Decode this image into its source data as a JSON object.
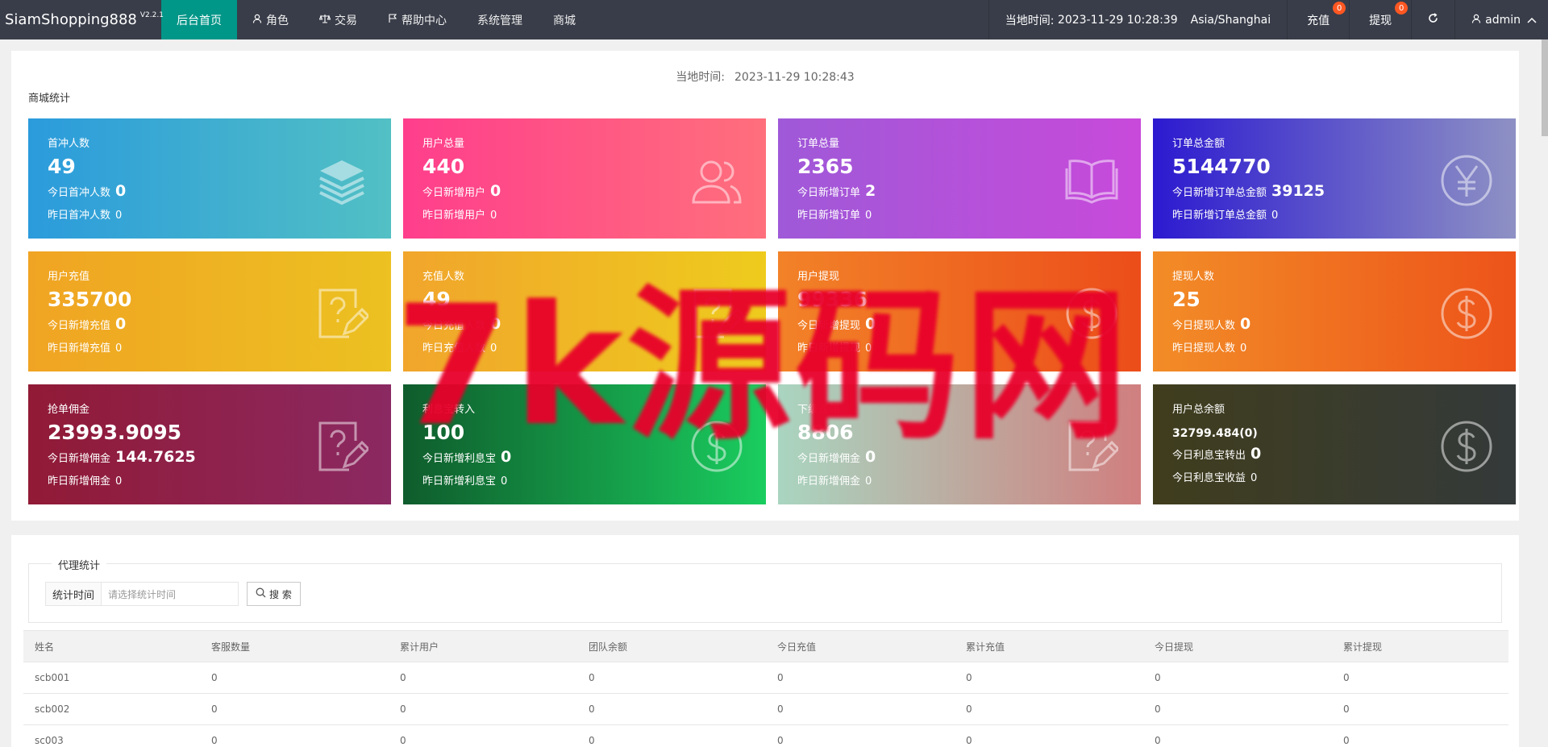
{
  "app": {
    "name": "SiamShopping888",
    "version": "V2.2.1"
  },
  "nav": [
    {
      "label": "后台首页",
      "icon": "",
      "active": true
    },
    {
      "label": "角色",
      "icon": "user-icon"
    },
    {
      "label": "交易",
      "icon": "scale-icon"
    },
    {
      "label": "帮助中心",
      "icon": "flag-icon"
    },
    {
      "label": "系统管理",
      "icon": ""
    },
    {
      "label": "商城",
      "icon": ""
    }
  ],
  "header": {
    "time_label": "当地时间:",
    "time_value": "2023-11-29 10:28:39",
    "timezone": "Asia/Shanghai",
    "recharge_label": "充值",
    "recharge_count": "0",
    "withdraw_label": "提现",
    "withdraw_count": "0",
    "user": "admin"
  },
  "stats": {
    "time_label": "当地时间:",
    "time_value": "2023-11-29 10:28:43",
    "title": "商城统计",
    "cards": [
      {
        "label": "首冲人数",
        "value": "49",
        "sub_label": "今日首冲人数",
        "sub_value": "0",
        "sub2_label": "昨日首冲人数",
        "sub2_value": "0",
        "icon": "layers-icon"
      },
      {
        "label": "用户总量",
        "value": "440",
        "sub_label": "今日新增用户",
        "sub_value": "0",
        "sub2_label": "昨日新增用户",
        "sub2_value": "0",
        "icon": "users-icon"
      },
      {
        "label": "订单总量",
        "value": "2365",
        "sub_label": "今日新增订单",
        "sub_value": "2",
        "sub2_label": "昨日新增订单",
        "sub2_value": "0",
        "icon": "book-icon"
      },
      {
        "label": "订单总金额",
        "value": "5144770",
        "sub_label": "今日新增订单总金额",
        "sub_value": "39125",
        "sub2_label": "昨日新增订单总金额",
        "sub2_value": "0",
        "icon": "yen-icon"
      },
      {
        "label": "用户充值",
        "value": "335700",
        "sub_label": "今日新增充值",
        "sub_value": "0",
        "sub2_label": "昨日新增充值",
        "sub2_value": "0",
        "icon": "edit-question-icon"
      },
      {
        "label": "充值人数",
        "value": "49",
        "sub_label": "今日充值人数",
        "sub_value": "0",
        "sub2_label": "昨日充值人数",
        "sub2_value": "0",
        "icon": "edit-question-icon"
      },
      {
        "label": "用户提现",
        "value": "99336",
        "sub_label": "今日新增提现",
        "sub_value": "0",
        "sub2_label": "昨日新增提现",
        "sub2_value": "0",
        "icon": "dollar-icon"
      },
      {
        "label": "提现人数",
        "value": "25",
        "sub_label": "今日提现人数",
        "sub_value": "0",
        "sub2_label": "昨日提现人数",
        "sub2_value": "0",
        "icon": "dollar-icon"
      },
      {
        "label": "抢单佣金",
        "value": "23993.9095",
        "sub_label": "今日新增佣金",
        "sub_value": "144.7625",
        "sub2_label": "昨日新增佣金",
        "sub2_value": "0",
        "icon": "edit-question-icon"
      },
      {
        "label": "利息宝转入",
        "value": "100",
        "sub_label": "今日新增利息宝",
        "sub_value": "0",
        "sub2_label": "昨日新增利息宝",
        "sub2_value": "0",
        "icon": "dollar-icon"
      },
      {
        "label": "下级返佣",
        "value": "8806",
        "sub_label": "今日新增佣金",
        "sub_value": "0",
        "sub2_label": "昨日新增佣金",
        "sub2_value": "0",
        "icon": "edit-question-icon"
      },
      {
        "label": "用户总余额",
        "value": "32799.484(0)",
        "sub_label": "今日利息宝转出",
        "sub_value": "0",
        "sub2_label": "今日利息宝收益",
        "sub2_value": "0",
        "icon": "dollar-icon",
        "small": true
      }
    ]
  },
  "watermark": "7k源码网",
  "agent": {
    "title": "代理统计",
    "filter_label": "统计时间",
    "filter_placeholder": "请选择统计时间",
    "search_label": "搜 索",
    "columns": [
      "姓名",
      "客服数量",
      "累计用户",
      "团队余额",
      "今日充值",
      "累计充值",
      "今日提现",
      "累计提现"
    ],
    "rows": [
      [
        "scb001",
        "0",
        "0",
        "0",
        "0",
        "0",
        "0",
        "0"
      ],
      [
        "scb002",
        "0",
        "0",
        "0",
        "0",
        "0",
        "0",
        "0"
      ],
      [
        "sc003",
        "0",
        "0",
        "0",
        "0",
        "0",
        "0",
        "0"
      ]
    ]
  }
}
